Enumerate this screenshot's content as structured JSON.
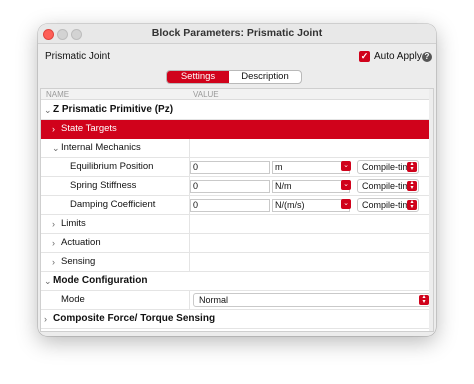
{
  "window": {
    "title": "Block Parameters: Prismatic Joint"
  },
  "block_name": "Prismatic Joint",
  "auto_apply": {
    "label": "Auto Apply",
    "checked": true
  },
  "help_icon": "question-circle-icon",
  "tabs": [
    {
      "label": "Settings",
      "active": true
    },
    {
      "label": "Description",
      "active": false
    }
  ],
  "columns": {
    "name": "NAME",
    "value": "VALUE"
  },
  "rows": {
    "primitive": {
      "label": "Z Prismatic Primitive (Pz)",
      "expanded": true
    },
    "state_targets": {
      "label": "State Targets",
      "expanded": false,
      "selected": true
    },
    "internal_mechanics": {
      "label": "Internal Mechanics",
      "expanded": true
    },
    "equilibrium": {
      "label": "Equilibrium Position",
      "value": "0",
      "unit": "m",
      "mode": "Compile-time"
    },
    "stiffness": {
      "label": "Spring Stiffness",
      "value": "0",
      "unit": "N/m",
      "mode": "Compile-time"
    },
    "damping": {
      "label": "Damping Coefficient",
      "value": "0",
      "unit": "N/(m/s)",
      "mode": "Compile-time"
    },
    "limits": {
      "label": "Limits",
      "expanded": false
    },
    "actuation": {
      "label": "Actuation",
      "expanded": false
    },
    "sensing": {
      "label": "Sensing",
      "expanded": false
    },
    "mode_config": {
      "label": "Mode Configuration",
      "expanded": true
    },
    "mode": {
      "label": "Mode",
      "value": "Normal"
    },
    "composite": {
      "label": "Composite Force/ Torque Sensing",
      "expanded": false
    }
  },
  "colors": {
    "accent": "#d0021b",
    "window_bg": "#ececec",
    "close": "#fe5f57"
  },
  "icons": {
    "expanded": "chevron-down-icon",
    "collapsed": "chevron-right-icon",
    "dropdown": "dropdown-arrow-icon",
    "stepper": "up-down-arrows-icon"
  }
}
